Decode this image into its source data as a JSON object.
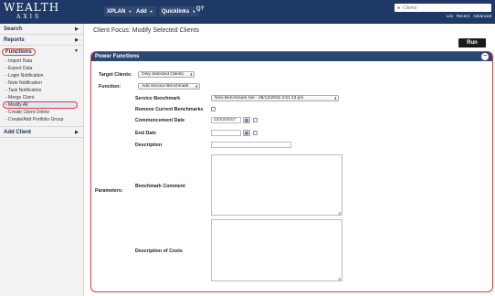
{
  "header": {
    "logo_line1": "WEALTH",
    "logo_line2": "AXIS",
    "menus": [
      {
        "label": "XPLAN"
      },
      {
        "label": "Add"
      },
      {
        "label": "Quicklinks"
      }
    ],
    "help_label": "Q?",
    "search": {
      "placeholder": "Clients",
      "value": ""
    },
    "links": [
      "List",
      "Recent",
      "Advanced"
    ]
  },
  "sidebar": {
    "sections": [
      {
        "label": "Search"
      },
      {
        "label": "Reports"
      },
      {
        "label": "Functions"
      },
      {
        "label": "Add Client"
      }
    ],
    "function_items": [
      "- Import Data",
      "- Export Data",
      "- Login Notification",
      "- Note Notification",
      "- Task Notification",
      "- Merge Client",
      "- Modify All",
      "- Create Client Online",
      "- Create/Add Portfolio Group"
    ]
  },
  "main": {
    "title": "Client Focus: Modify Selected Clients",
    "run_label": "Run",
    "panel_title": "Power Functions",
    "collapse_symbol": "−",
    "target_clients_label": "Target Clients:",
    "target_clients_value": "Only Selected Clients",
    "function_label": "Function:",
    "function_value": "Add Service Benchmark",
    "parameters_label": "Parameters:",
    "service_benchmark_label": "Service Benchmark",
    "service_benchmark_value": "New Benchmark Set - 29/12/2015 2:51:13 pm",
    "remove_benchmarks_label": "Remove Current Benchmarks",
    "commencement_label": "Commencement Date",
    "commencement_value": "12/12/2017",
    "end_date_label": "End Date",
    "end_date_value": "",
    "description_label": "Description",
    "description_value": "",
    "benchmark_comment_label": "Benchmark Comment",
    "description_costs_label": "Description of Costs"
  }
}
